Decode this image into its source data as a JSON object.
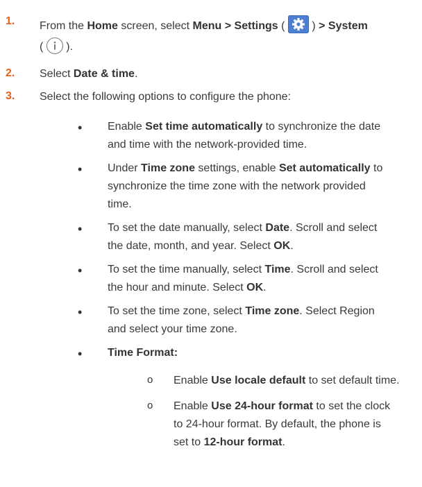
{
  "steps": [
    {
      "number": "1.",
      "line1": {
        "t1": "From the ",
        "home": "Home",
        "t2": " screen, select ",
        "menu_settings": "Menu > Settings",
        "t3": " (",
        "t4": ")",
        "system": " > System"
      },
      "line2": {
        "open": "(",
        "close": ")."
      }
    },
    {
      "number": "2.",
      "t1": "Select ",
      "date_time": "Date & time",
      "t2": "."
    },
    {
      "number": "3.",
      "text": "Select the following options to configure the phone:"
    }
  ],
  "bullets": {
    "b1": {
      "t1": "Enable ",
      "bold1": "Set time automatically",
      "t2": " to synchronize the date",
      "line2": "and time with the network-provided time."
    },
    "b2": {
      "t1": "Under ",
      "bold1": "Time zone",
      "t2": " settings, enable ",
      "bold2": "Set automatically",
      "t3": " to",
      "line2": "synchronize the time zone with the network provided",
      "line3": "time."
    },
    "b3": {
      "t1": "To set the date manually, select ",
      "bold1": "Date",
      "t2": ". Scroll and select",
      "line2a": "the date, month, and year. Select ",
      "bold2": "OK",
      "t3": "."
    },
    "b4": {
      "t1": "To set the time manually, select ",
      "bold1": "Time",
      "t2": ". Scroll and select",
      "line2a": "the hour and minute. Select ",
      "bold2": "OK",
      "t3": "."
    },
    "b5": {
      "t1": "To set the time zone, select ",
      "bold1": "Time zone",
      "t2": ". Select Region",
      "line2": "and select your time zone."
    },
    "b6": {
      "bold1": "Time Format:"
    }
  },
  "sub_bullets": {
    "s1": {
      "t1": "Enable ",
      "bold1": "Use locale default",
      "t2": " to set default time."
    },
    "s2": {
      "t1": "Enable ",
      "bold1": "Use 24-hour format",
      "t2": " to set the clock",
      "line2": "to 24-hour format. By default, the phone is",
      "line3a": "set to ",
      "bold2": "12-hour format",
      "t3": "."
    }
  },
  "bullet_glyph": "•",
  "sub_bullet_glyph": "o",
  "icons": [
    "gear-icon",
    "info-icon"
  ],
  "colors": {
    "step_number": "#e8601c",
    "gear_bg": "#4f7fd0"
  }
}
